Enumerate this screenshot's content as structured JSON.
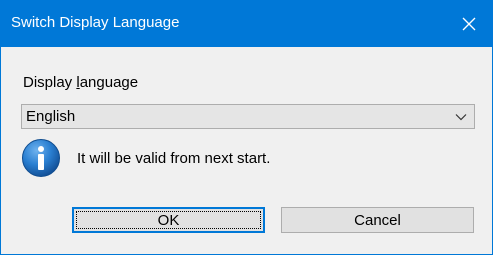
{
  "window": {
    "title": "Switch Display Language",
    "close_icon": "close-icon"
  },
  "form": {
    "label_prefix": "Display ",
    "label_accel": "l",
    "label_suffix": "anguage",
    "selected_language": "English"
  },
  "message": {
    "icon": "info-icon",
    "text": "It will be valid from next start."
  },
  "buttons": {
    "ok_label": "OK",
    "cancel_label": "Cancel"
  },
  "colors": {
    "titlebar": "#0078d7",
    "dialog_bg": "#f0f0f0",
    "info_icon": "#1e6fbf"
  }
}
